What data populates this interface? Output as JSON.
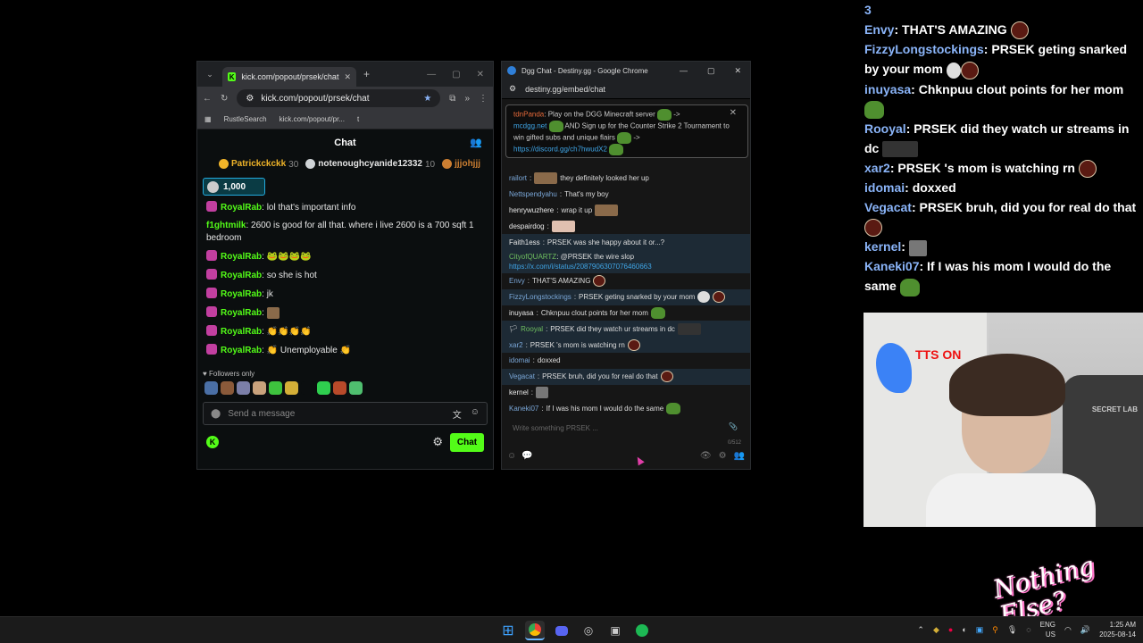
{
  "kick": {
    "tab_title": "kick.com/popout/prsek/chat",
    "url": "kick.com/popout/prsek/chat",
    "bookmarks": [
      "RustleSearch",
      "kick.com/popout/pr...",
      "t"
    ],
    "chat_title": "Chat",
    "gifters": [
      {
        "name": "Patrickckckk",
        "count": "30"
      },
      {
        "name": "notenoughcyanide12332",
        "count": "10"
      },
      {
        "name": "jjjohjjj",
        "count": ""
      }
    ],
    "pinned_amount": "1,000",
    "messages": [
      {
        "user": "RoyalRab",
        "sep": ":",
        "text": "lol that's important info",
        "badge": true,
        "color": "#53fc18"
      },
      {
        "user": "f1ghtmilk",
        "sep": ":",
        "text": "2600 is good for all that. where i live 2600 is a 700 sqft 1 bedroom",
        "badge": false,
        "color": "#53fc18"
      },
      {
        "user": "RoyalRab",
        "sep": ":",
        "text": "🐸🐸🐸🐸",
        "badge": true,
        "color": "#53fc18"
      },
      {
        "user": "RoyalRab",
        "sep": ":",
        "text": "so she is hot",
        "badge": true,
        "color": "#53fc18"
      },
      {
        "user": "RoyalRab",
        "sep": ":",
        "text": "jk",
        "badge": true,
        "color": "#53fc18"
      },
      {
        "user": "RoyalRab",
        "sep": ":",
        "text": "",
        "badge": true,
        "color": "#53fc18"
      },
      {
        "user": "RoyalRab",
        "sep": ":",
        "text": "👏👏👏👏",
        "badge": true,
        "color": "#53fc18"
      },
      {
        "user": "RoyalRab",
        "sep": ":",
        "text": "👏 Unemployable 👏",
        "badge": true,
        "color": "#53fc18"
      }
    ],
    "followers_only": "Followers only",
    "input_placeholder": "Send a message",
    "send_label": "Chat"
  },
  "dgg": {
    "window_title": "Dgg Chat - Destiny.gg - Google Chrome",
    "url": "destiny.gg/embed/chat",
    "notice": {
      "user": "tdnPanda",
      "line1": ": Play on the DGG Minecraft server",
      "arrow1": "->",
      "link1": "mcdgg.net",
      "line2": "AND Sign up for the Counter Strike 2 Tournament to win gifted subs and unique flairs",
      "arrow2": "->",
      "link2": "https://discord.gg/ch7hwudX2"
    },
    "lines": [
      {
        "user": "railort",
        "text": "they definitely looked her up",
        "hl": false
      },
      {
        "user": "Nettspendyahu",
        "text": "That's my boy",
        "hl": false
      },
      {
        "user": "henrywuzhere",
        "text": "wrap it up",
        "hl": false
      },
      {
        "user": "despairdog",
        "text": "",
        "hl": false
      },
      {
        "user": "Faith1ess",
        "text": "PRSEK was she happy about it or...?",
        "hl": true
      },
      {
        "user": "CityofQUARTZ",
        "text": "@PRSEK the wire slop",
        "hl": true,
        "link": "https://x.com/i/status/2087906307076460663"
      },
      {
        "user": "Envy",
        "text": "THAT'S AMAZING",
        "hl": false
      },
      {
        "user": "FizzyLongstockings",
        "text": "PRSEK geting snarked by your mom",
        "hl": true
      },
      {
        "user": "inuyasa",
        "text": "Chknpuu clout points for her mom",
        "hl": false
      },
      {
        "user": "Rooyal",
        "text": "PRSEK did they watch ur streams in dc",
        "hl": true
      },
      {
        "user": "xar2",
        "text": "PRSEK 's mom is watching rn",
        "hl": true
      },
      {
        "user": "idomai",
        "text": "doxxed",
        "hl": false
      },
      {
        "user": "Vegacat",
        "text": "PRSEK bruh, did you for real do that",
        "hl": true
      },
      {
        "user": "kernel",
        "text": "",
        "hl": false
      },
      {
        "user": "Kaneki07",
        "text": "If I was his mom I would do the same",
        "hl": false
      }
    ],
    "input_placeholder": "Write something PRSEK ...",
    "char_count": "0/512"
  },
  "overlay": {
    "top_fragment": "3",
    "messages": [
      {
        "user": "Envy",
        "text": "THAT'S AMAZING"
      },
      {
        "user": "FizzyLongstockings",
        "text": "PRSEK geting snarked by your mom"
      },
      {
        "user": "inuyasa",
        "text": "Chknpuu clout points for her mom"
      },
      {
        "user": "Rooyal",
        "text": "PRSEK did they watch ur streams in dc"
      },
      {
        "user": "xar2",
        "text": "PRSEK 's mom is watching rn"
      },
      {
        "user": "idomai",
        "text": "doxxed"
      },
      {
        "user": "Vegacat",
        "text": "PRSEK bruh, did you for real do that"
      },
      {
        "user": "kernel",
        "text": ""
      },
      {
        "user": "Kaneki07",
        "text": "If I was his mom I would do the same"
      }
    ]
  },
  "webcam": {
    "sticker_text": "TTS ON",
    "chair_text": "SECRET LAB"
  },
  "logo_text": "Nothing Else?",
  "taskbar": {
    "lang": "ENG",
    "region": "US",
    "time": "1:25 AM",
    "date": "2025-08-14"
  },
  "colors": {
    "kick_green": "#53fc18",
    "dgg_link": "#3fa5e6",
    "dgg_user": "#7aa7d8",
    "overlay_user": "#8ab4f8"
  }
}
